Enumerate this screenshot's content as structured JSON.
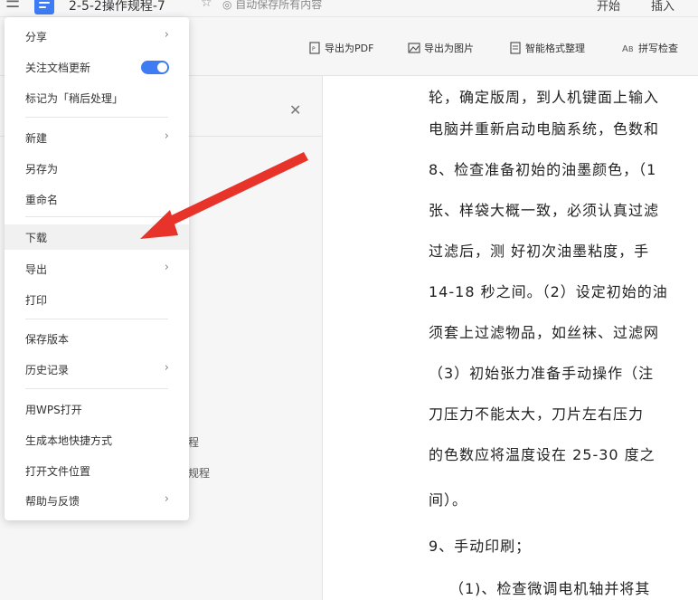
{
  "titlebar": {
    "doc_title": "2-5-2操作规程-7",
    "autosave": "自动保存所有内容",
    "tabs": [
      "开始",
      "插入"
    ]
  },
  "toolbar": {
    "items": [
      "导出为PDF",
      "导出为图片",
      "智能格式整理",
      "拼写检查"
    ]
  },
  "panel": {
    "outline_items": [
      "程",
      "规程"
    ]
  },
  "menu": {
    "items": {
      "share": "分享",
      "follow_updates": "关注文档更新",
      "mark_later": "标记为「稍后处理」",
      "new": "新建",
      "save_as": "另存为",
      "rename": "重命名",
      "download": "下载",
      "export": "导出",
      "print": "打印",
      "save_version": "保存版本",
      "history": "历史记录",
      "open_wps": "用WPS打开",
      "create_shortcut": "生成本地快捷方式",
      "open_location": "打开文件位置",
      "help_feedback": "帮助与反馈"
    },
    "follow_updates_on": true
  },
  "document": {
    "lines": [
      "轮，确定版周，到人机键面上输入",
      "电脑并重新启动电脑系统，色数和",
      "8、检查准备初始的油墨颜色，（1",
      "张、样袋大概一致，必须认真过滤",
      "过滤后，测 好初次油墨粘度，手",
      "14-18 秒之间。（2）设定初始的油",
      "须套上过滤物品，如丝袜、过滤网",
      "（3）初始张力准备手动操作（注",
      "刀压力不能太大，刀片左右压力",
      "的色数应将温度设在 25-30 度之",
      "间）。",
      "9、手动印刷；",
      "（1)、检查微调电机轴并将其"
    ]
  },
  "colors": {
    "accent": "#3d7cf4",
    "arrow": "#e8332b"
  }
}
